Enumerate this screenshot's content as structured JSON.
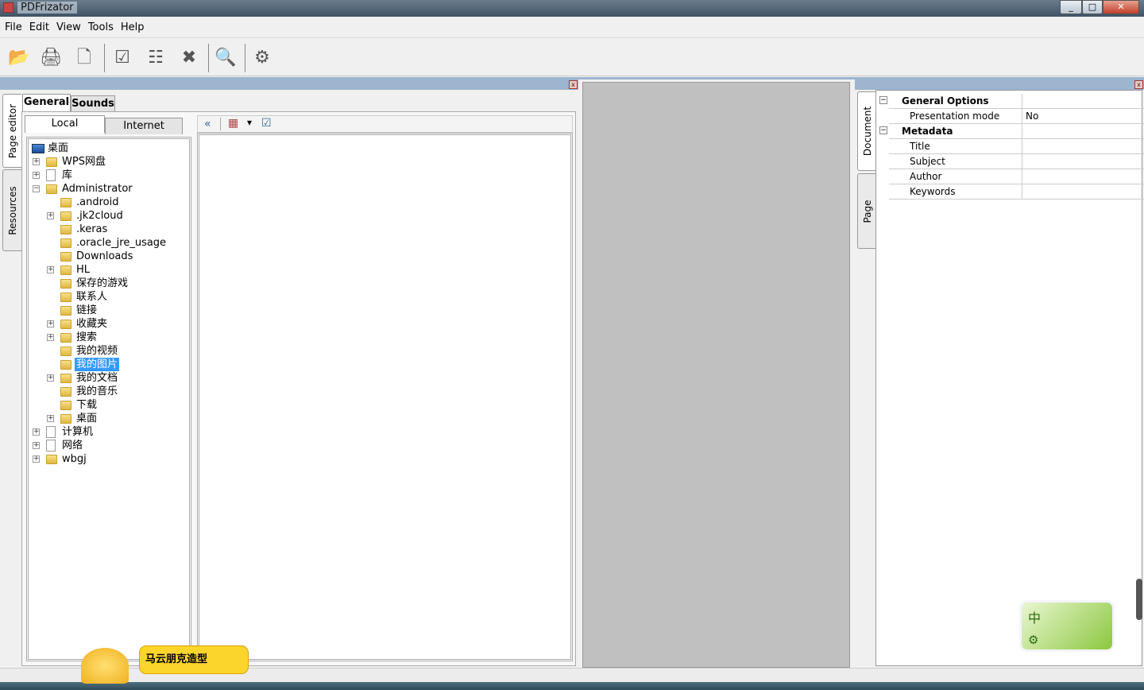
{
  "window": {
    "title": "PDFrizator",
    "min": "_",
    "max": "□",
    "close": "✕"
  },
  "menu": [
    "File",
    "Edit",
    "View",
    "Tools",
    "Help"
  ],
  "toolbar": [
    {
      "name": "open-folder-icon",
      "glyph": "📂"
    },
    {
      "name": "scanner-icon",
      "glyph": "🖨"
    },
    {
      "name": "new-document-icon",
      "glyph": "🗋"
    },
    {
      "name": "check-all-icon",
      "glyph": "☑"
    },
    {
      "name": "check-grid-icon",
      "glyph": "☷"
    },
    {
      "name": "delete-icon",
      "glyph": "✖"
    },
    {
      "name": "zoom-icon",
      "glyph": "🔍"
    },
    {
      "name": "page-settings-icon",
      "glyph": "⚙"
    }
  ],
  "left_panel": {
    "vtabs": [
      "Page editor",
      "Resources"
    ],
    "tabs": [
      "General",
      "Sounds"
    ],
    "subtabs": [
      "Local",
      "Internet"
    ],
    "tree": [
      {
        "label": "桌面",
        "level": 0,
        "icon": "computer",
        "exp": ""
      },
      {
        "label": "WPS网盘",
        "level": 1,
        "icon": "folder",
        "exp": "+"
      },
      {
        "label": "库",
        "level": 1,
        "icon": "doc",
        "exp": "+"
      },
      {
        "label": "Administrator",
        "level": 1,
        "icon": "folder",
        "exp": "−"
      },
      {
        "label": ".android",
        "level": 2,
        "icon": "folder",
        "exp": ""
      },
      {
        "label": ".jk2cloud",
        "level": 2,
        "icon": "folder",
        "exp": "+"
      },
      {
        "label": ".keras",
        "level": 2,
        "icon": "folder",
        "exp": ""
      },
      {
        "label": ".oracle_jre_usage",
        "level": 2,
        "icon": "folder",
        "exp": ""
      },
      {
        "label": "Downloads",
        "level": 2,
        "icon": "folder",
        "exp": ""
      },
      {
        "label": "HL",
        "level": 2,
        "icon": "folder",
        "exp": "+"
      },
      {
        "label": "保存的游戏",
        "level": 2,
        "icon": "folder",
        "exp": ""
      },
      {
        "label": "联系人",
        "level": 2,
        "icon": "folder",
        "exp": ""
      },
      {
        "label": "链接",
        "level": 2,
        "icon": "folder",
        "exp": ""
      },
      {
        "label": "收藏夹",
        "level": 2,
        "icon": "folder",
        "exp": "+"
      },
      {
        "label": "搜索",
        "level": 2,
        "icon": "folder",
        "exp": "+"
      },
      {
        "label": "我的视频",
        "level": 2,
        "icon": "folder",
        "exp": ""
      },
      {
        "label": "我的图片",
        "level": 2,
        "icon": "folder",
        "exp": "",
        "selected": true
      },
      {
        "label": "我的文档",
        "level": 2,
        "icon": "folder",
        "exp": "+"
      },
      {
        "label": "我的音乐",
        "level": 2,
        "icon": "folder",
        "exp": ""
      },
      {
        "label": "下载",
        "level": 2,
        "icon": "folder",
        "exp": ""
      },
      {
        "label": "桌面",
        "level": 2,
        "icon": "folder",
        "exp": "+"
      },
      {
        "label": "计算机",
        "level": 1,
        "icon": "doc",
        "exp": "+"
      },
      {
        "label": "网络",
        "level": 1,
        "icon": "doc",
        "exp": "+"
      },
      {
        "label": "wbgj",
        "level": 1,
        "icon": "folder",
        "exp": "+"
      }
    ],
    "file_toolbar": {
      "collapse": "«",
      "view": "▦",
      "dropdown": "▾",
      "select": "☑"
    }
  },
  "right_panel": {
    "vtabs": [
      "Document",
      "Page"
    ],
    "properties": [
      {
        "key": "General Options",
        "value": "",
        "category": true
      },
      {
        "key": "Presentation mode",
        "value": "No"
      },
      {
        "key": "Metadata",
        "value": "",
        "category": true
      },
      {
        "key": "Title",
        "value": ""
      },
      {
        "key": "Subject",
        "value": ""
      },
      {
        "key": "Author",
        "value": ""
      },
      {
        "key": "Keywords",
        "value": ""
      }
    ]
  },
  "overlay": {
    "tooltip": "马云朋克造型",
    "ime": "中"
  }
}
